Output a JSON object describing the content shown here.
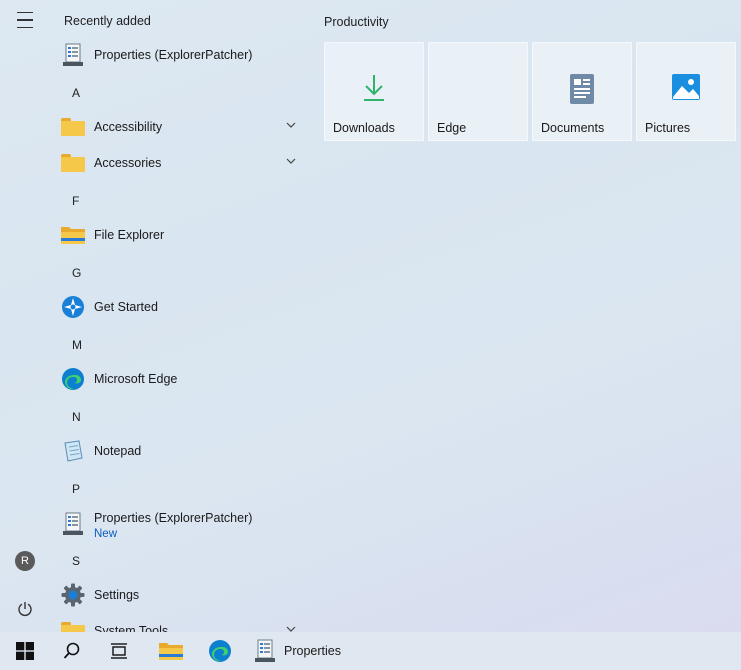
{
  "start_menu": {
    "recently_added_heading": "Recently added",
    "recent_item": {
      "label": "Properties (ExplorerPatcher)"
    },
    "groups": [
      {
        "letter": "A",
        "items": [
          {
            "label": "Accessibility",
            "icon": "folder-icon",
            "expandable": true
          },
          {
            "label": "Accessories",
            "icon": "folder-icon",
            "expandable": true
          }
        ]
      },
      {
        "letter": "F",
        "items": [
          {
            "label": "File Explorer",
            "icon": "file-explorer-icon"
          }
        ]
      },
      {
        "letter": "G",
        "items": [
          {
            "label": "Get Started",
            "icon": "get-started-icon"
          }
        ]
      },
      {
        "letter": "M",
        "items": [
          {
            "label": "Microsoft Edge",
            "icon": "edge-icon"
          }
        ]
      },
      {
        "letter": "N",
        "items": [
          {
            "label": "Notepad",
            "icon": "notepad-icon"
          }
        ]
      },
      {
        "letter": "P",
        "items": [
          {
            "label": "Properties (ExplorerPatcher)",
            "sublabel": "New",
            "icon": "properties-icon"
          }
        ]
      },
      {
        "letter": "S",
        "items": [
          {
            "label": "Settings",
            "icon": "settings-gear-icon"
          },
          {
            "label": "System Tools",
            "icon": "folder-icon",
            "expandable": true
          }
        ]
      }
    ],
    "rail": {
      "avatar_initial": "R"
    }
  },
  "productivity": {
    "heading": "Productivity",
    "tiles": [
      {
        "label": "Downloads",
        "icon": "download-arrow-icon"
      },
      {
        "label": "Edge",
        "icon": "blank"
      },
      {
        "label": "Documents",
        "icon": "document-icon"
      },
      {
        "label": "Pictures",
        "icon": "pictures-icon"
      }
    ]
  },
  "taskbar": {
    "properties_label": "Properties"
  },
  "colors": {
    "accent_new": "#0a5ec2",
    "folder": "#f6c84a",
    "downloads_green": "#2fb36b",
    "pictures_blue": "#1a8fe0"
  }
}
